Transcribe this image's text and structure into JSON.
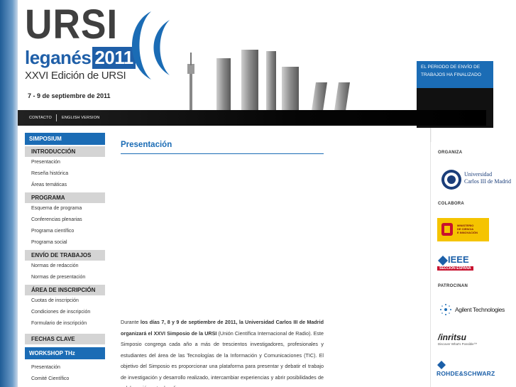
{
  "header": {
    "logo_main": "URSI",
    "logo_city": "leganés",
    "logo_year": "2011",
    "logo_edition": "XXVI Edición de URSI",
    "dates": "7 - 9 de septiembre de 2011"
  },
  "notice": {
    "text": "EL PERIODO DE ENVÍO DE TRABAJOS HA FINALIZADO"
  },
  "nav": {
    "contacto": "CONTACTO",
    "english": "ENGLISH VERSION"
  },
  "sidebar": {
    "simposium": "SIMPOSIUM",
    "introduccion": "INTRODUCCIÓN",
    "intro_items": [
      "Presentación",
      "Reseña histórica",
      "Áreas temáticas"
    ],
    "programa": "PROGRAMA",
    "programa_items": [
      "Esquema de programa",
      "Conferencias plenarias",
      "Programa científico",
      "Programa social"
    ],
    "envio": "ENVÍO DE TRABAJOS",
    "envio_items": [
      "Normas de redacción",
      "Normas de presentación"
    ],
    "inscripcion": "ÁREA DE INSCRIPCIÓN",
    "inscripcion_items": [
      "Cuotas de inscripción",
      "Condiciones de inscripción",
      "Formulario de inscripción"
    ],
    "fechas": "FECHAS CLAVE",
    "workshop": "WORKSHOP THz",
    "workshop_items": [
      "Presentación",
      "Comité Científico"
    ]
  },
  "main": {
    "title": "Presentación",
    "para_intro": "Durante ",
    "para_bold": "los días 7, 8 y 9 de septiembre de 2011, la Universidad Carlos III de Madrid organizará el XXVI Simposio de la URSI",
    "para_rest": " (Unión Científica Internacional de Radio). Este Simposio congrega cada año a más de trescientos investigadores, profesionales y estudiantes del área de las Tecnologías de la Información y Comunicaciones (TIC). El objetivo del Simposio es proporcionar una plataforma para presentar y debatir el trabajo de investigación y desarrollo realizado, intercambiar experiencias y abrir posibilidades de colaboración entre los diversos"
  },
  "right": {
    "organiza": "ORGANIZA",
    "colabora": "COLABORA",
    "patrocinan": "PATROCINAN",
    "uc3m_line1": "Universidad",
    "uc3m_line2": "Carlos III de Madrid",
    "ministerio_line1": "MINISTERIO",
    "ministerio_line2": "DE CIENCIA",
    "ministerio_line3": "E INNOVACIÓN",
    "ieee": "IEEE",
    "ieee_sub": "SECCIÓN ESPAÑA",
    "agilent": "Agilent Technologies",
    "anritsu": "/inritsu",
    "anritsu_sub": "Discover What's Possible™",
    "rohde": "ROHDE&SCHWARZ"
  },
  "colors": {
    "accent": "#1b6cb5",
    "dark": "#111111",
    "sidebar_grey": "#d4d4d4"
  }
}
